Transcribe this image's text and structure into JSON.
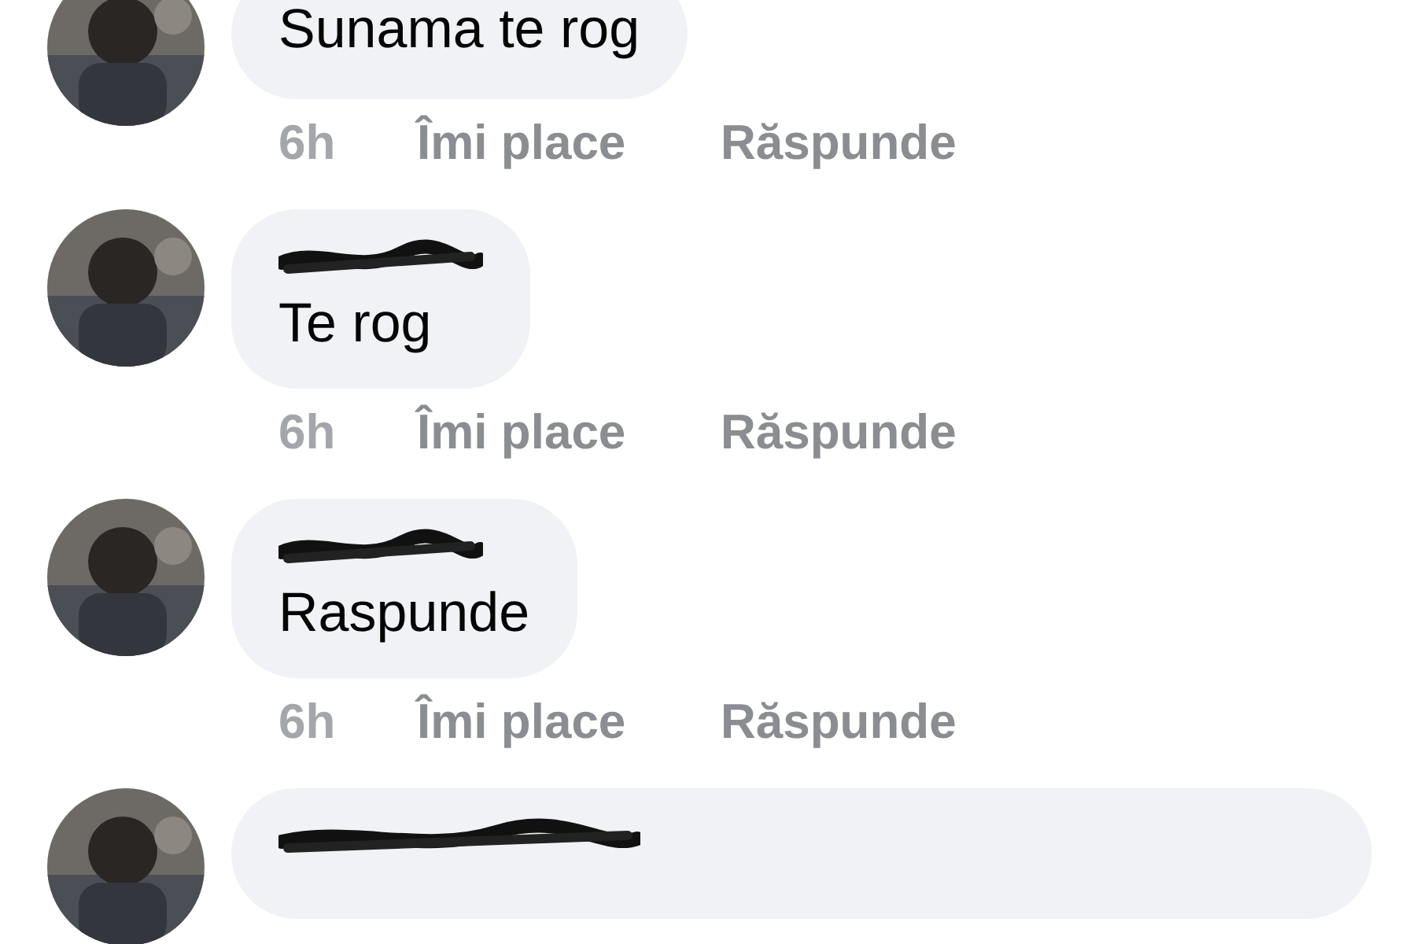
{
  "comments": [
    {
      "text": "Sunama te rog",
      "time": "6h",
      "like": "Îmi place",
      "reply": "Răspunde"
    },
    {
      "name_hidden": true,
      "text": "Te rog",
      "time": "6h",
      "like": "Îmi place",
      "reply": "Răspunde"
    },
    {
      "name_hidden": true,
      "text": "Raspunde",
      "time": "6h",
      "like": "Îmi place",
      "reply": "Răspunde"
    },
    {
      "name_hidden": true,
      "wide": true
    }
  ]
}
